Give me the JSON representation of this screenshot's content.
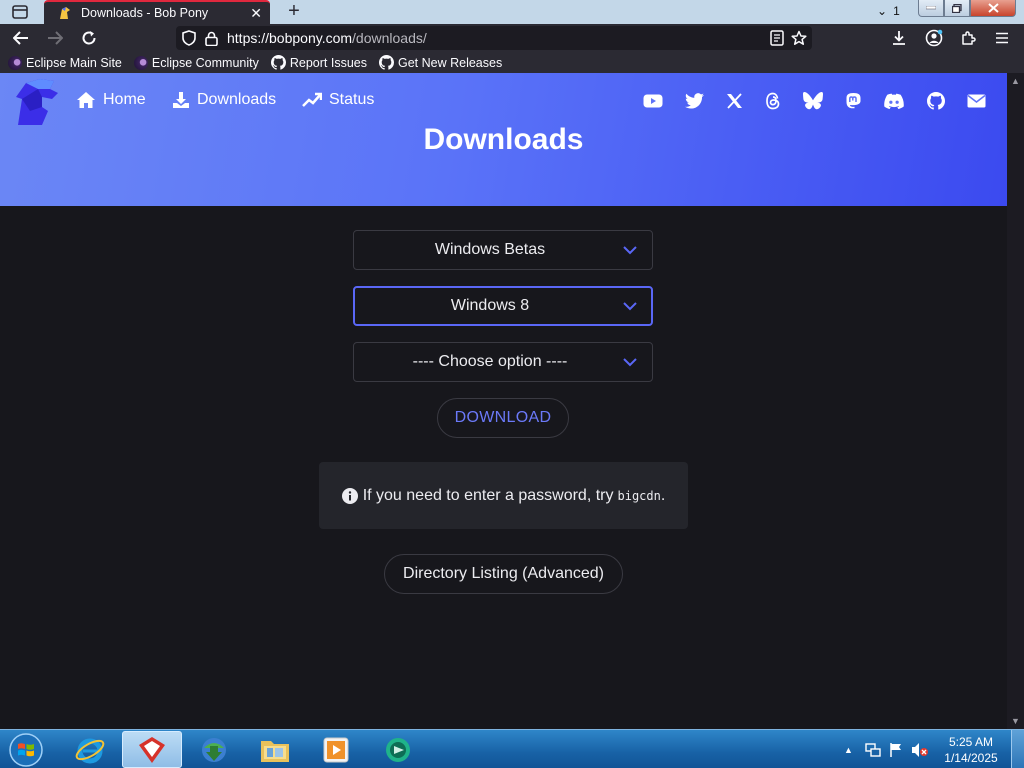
{
  "browser": {
    "tab_title": "Downloads - Bob Pony",
    "tab_count": "1",
    "url_host": "https://bobpony.com",
    "url_path": "/downloads/"
  },
  "bookmarks": [
    {
      "label": "Eclipse Main Site",
      "icon": "eclipse-icon"
    },
    {
      "label": "Eclipse Community",
      "icon": "eclipse-icon"
    },
    {
      "label": "Report Issues",
      "icon": "github-icon"
    },
    {
      "label": "Get New Releases",
      "icon": "github-icon"
    }
  ],
  "site_nav": {
    "links": [
      {
        "label": "Home",
        "icon": "home-icon"
      },
      {
        "label": "Downloads",
        "icon": "download-icon"
      },
      {
        "label": "Status",
        "icon": "trend-icon"
      }
    ],
    "social": [
      "youtube-icon",
      "twitter-icon",
      "x-icon",
      "threads-icon",
      "bluesky-icon",
      "mastodon-icon",
      "discord-icon",
      "github-icon",
      "email-icon"
    ]
  },
  "page": {
    "title": "Downloads",
    "selects": [
      {
        "value": "Windows Betas"
      },
      {
        "value": "Windows 8"
      },
      {
        "value": "---- Choose option ----"
      }
    ],
    "download_label": "DOWNLOAD",
    "notice_text": "If you need to enter a password, try",
    "notice_code": "bigcdn",
    "notice_end": ".",
    "directory_label": "Directory Listing (Advanced)"
  },
  "taskbar": {
    "time": "5:25 AM",
    "date": "1/14/2025"
  },
  "colors": {
    "accent": "#5a67f6",
    "hero_start": "#6b87f5",
    "hero_end": "#3b4af0",
    "tab_accent": "#e0283e"
  }
}
